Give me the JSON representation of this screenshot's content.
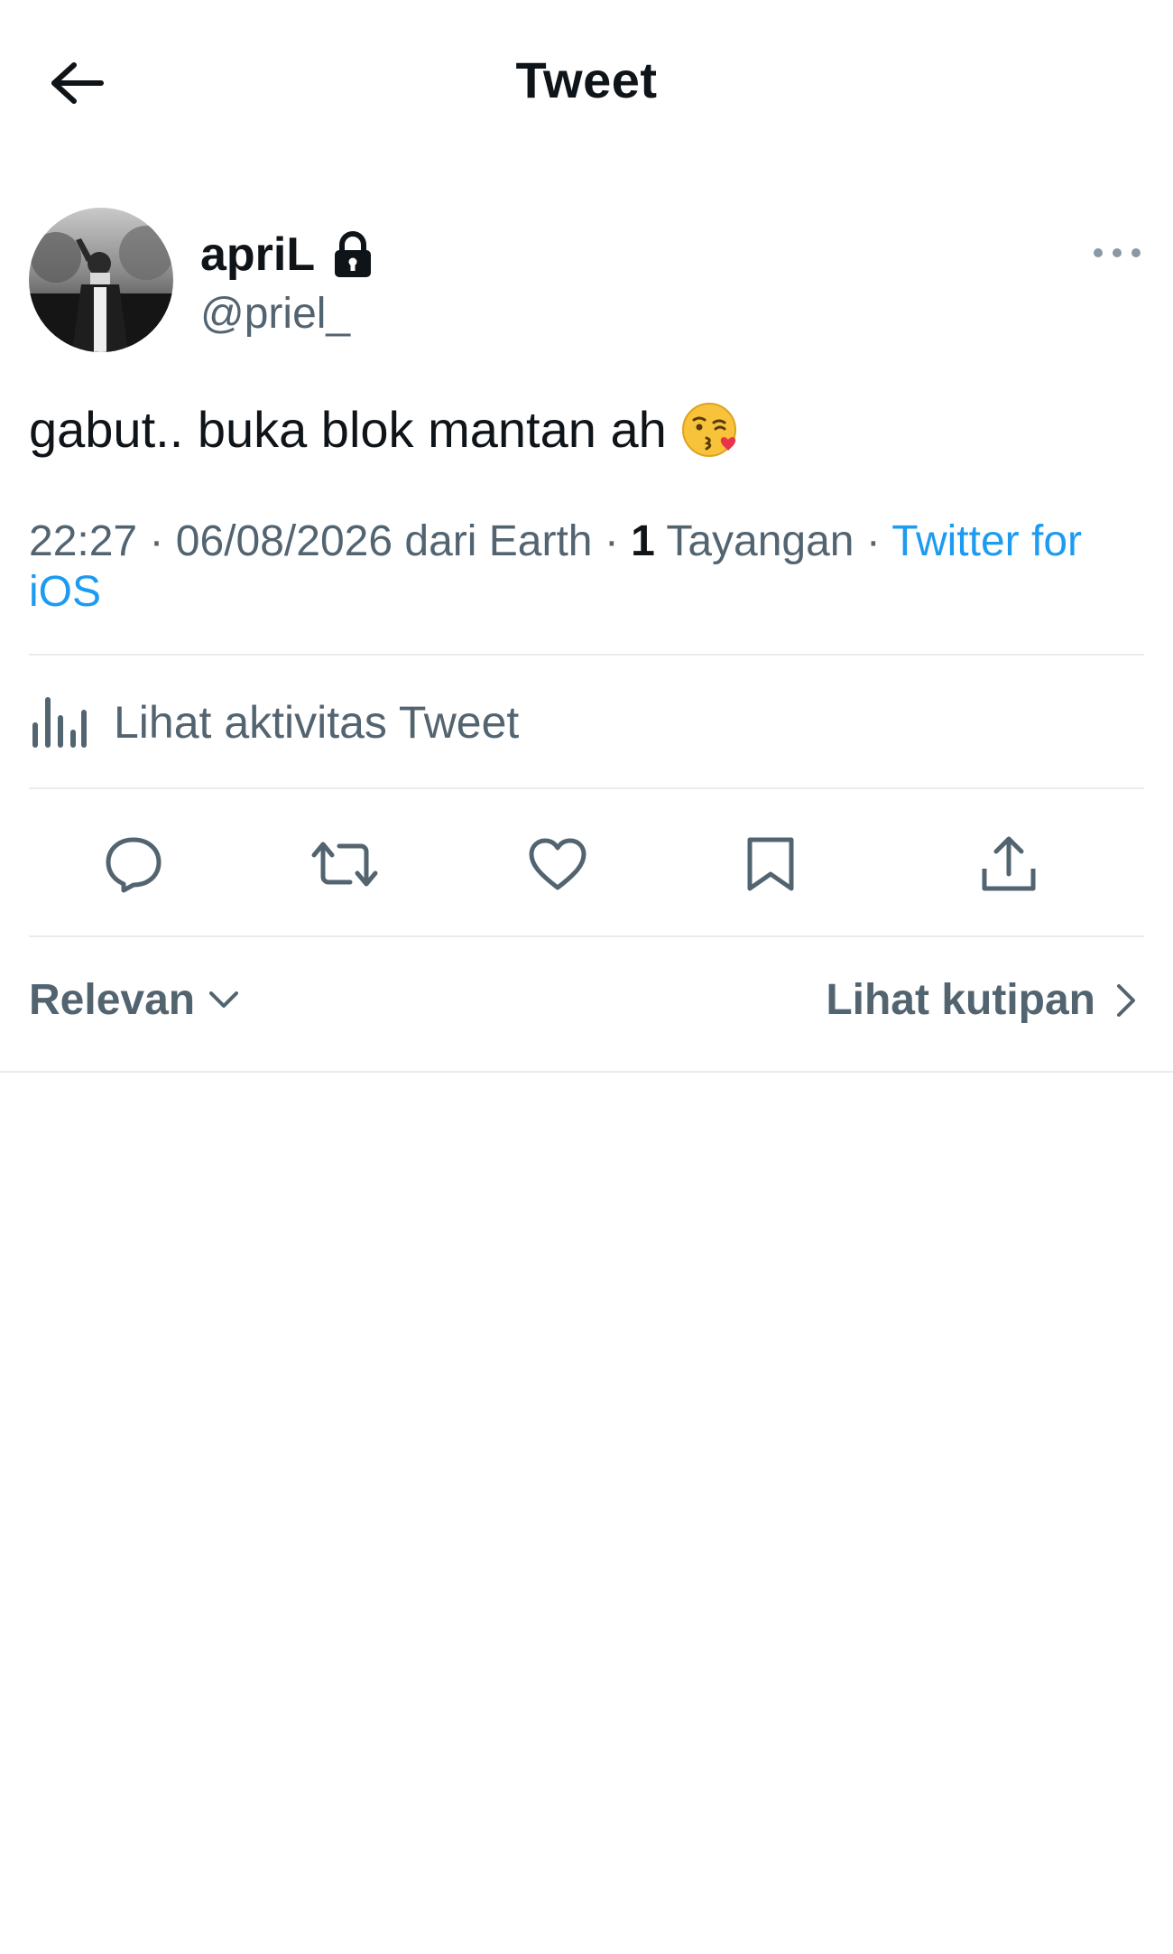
{
  "header": {
    "title": "Tweet",
    "back_icon": "arrow-left-icon"
  },
  "author": {
    "display_name": "apriL",
    "handle": "@priel_",
    "protected_icon": "lock-icon",
    "more_icon": "more-horizontal-icon"
  },
  "tweet": {
    "text": "gabut.. buka blok mantan ah",
    "emoji": "face-blowing-a-kiss",
    "time": "22:27",
    "date": "06/08/2026",
    "location_prefix": "dari Earth",
    "views_count": "1",
    "views_label": "Tayangan",
    "source": "Twitter for iOS",
    "separator": "·"
  },
  "activity": {
    "label": "Lihat aktivitas Tweet",
    "icon": "bar-chart-icon"
  },
  "actions": [
    {
      "name": "reply",
      "icon": "reply-icon"
    },
    {
      "name": "retweet",
      "icon": "retweet-icon"
    },
    {
      "name": "like",
      "icon": "heart-icon"
    },
    {
      "name": "bookmark",
      "icon": "bookmark-icon"
    },
    {
      "name": "share",
      "icon": "share-icon"
    }
  ],
  "replies": {
    "sort_label": "Relevan",
    "quotes_label": "Lihat kutipan"
  },
  "colors": {
    "text_primary": "#0f1419",
    "text_secondary": "#536471",
    "link": "#1d9bf0",
    "divider": "#e6ecf0"
  }
}
